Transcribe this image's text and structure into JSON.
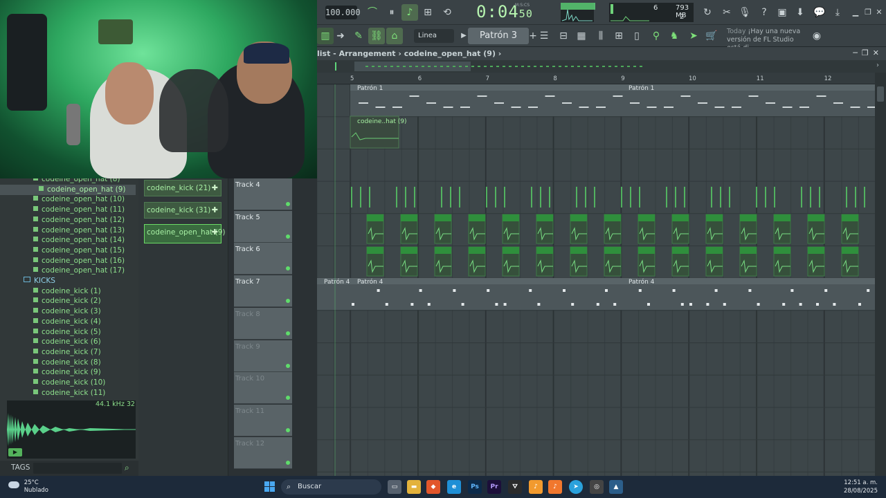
{
  "toolbar": {
    "tempo": "100.000",
    "time_main": "0:04",
    "time_small": "50",
    "time_format": "M:S:CS",
    "cpu_count": "6",
    "memory": "793 MB",
    "poly": "2",
    "mode": "Linea",
    "pattern": "Patrón 3",
    "news_label": "Today",
    "news_text": "¡Hay una nueva versión de FL Studio está di..."
  },
  "playlist": {
    "title": "list - Arrangement › codeine_open_hat (9) ›",
    "ruler": [
      "5",
      "6",
      "7",
      "8",
      "9",
      "10",
      "11",
      "12"
    ],
    "pattern_labels": [
      "Patrón 1",
      "Patrón 1",
      "Patrón 4",
      "Patrón 4"
    ],
    "clip_label": "codeine..hat (9)",
    "track_name": "Track",
    "track_numbers": [
      "4",
      "5",
      "6",
      "7",
      "8",
      "9",
      "10",
      "11",
      "12"
    ]
  },
  "browser": {
    "items": [
      "codeine_open_hat (8)",
      "codeine_open_hat (9)",
      "codeine_open_hat (10)",
      "codeine_open_hat (11)",
      "codeine_open_hat (12)",
      "codeine_open_hat (13)",
      "codeine_open_hat (14)",
      "codeine_open_hat (15)",
      "codeine_open_hat (16)",
      "codeine_open_hat (17)"
    ],
    "folder": "KICKS",
    "kicks": [
      "codeine_kick (1)",
      "codeine_kick (2)",
      "codeine_kick (3)",
      "codeine_kick (4)",
      "codeine_kick (5)",
      "codeine_kick (6)",
      "codeine_kick (7)",
      "codeine_kick (8)",
      "codeine_kick (9)",
      "codeine_kick (10)",
      "codeine_kick (11)"
    ],
    "sample_rate": "44.1 kHz 32",
    "tags_label": "TAGS"
  },
  "picker": {
    "items": [
      "codeine_kick (21)",
      "codeine_kick (31)",
      "codeine_open_hat (9)"
    ]
  },
  "taskbar": {
    "temp": "25°C",
    "weather": "Nublado",
    "search": "Buscar",
    "time": "12:51 a. m.",
    "date": "28/08/2025",
    "apps": [
      "Ps",
      "Pr"
    ]
  },
  "colors": {
    "accent": "#7ee07a",
    "clip_green": "#2f8f3c",
    "grid_bg": "#3d4649"
  }
}
